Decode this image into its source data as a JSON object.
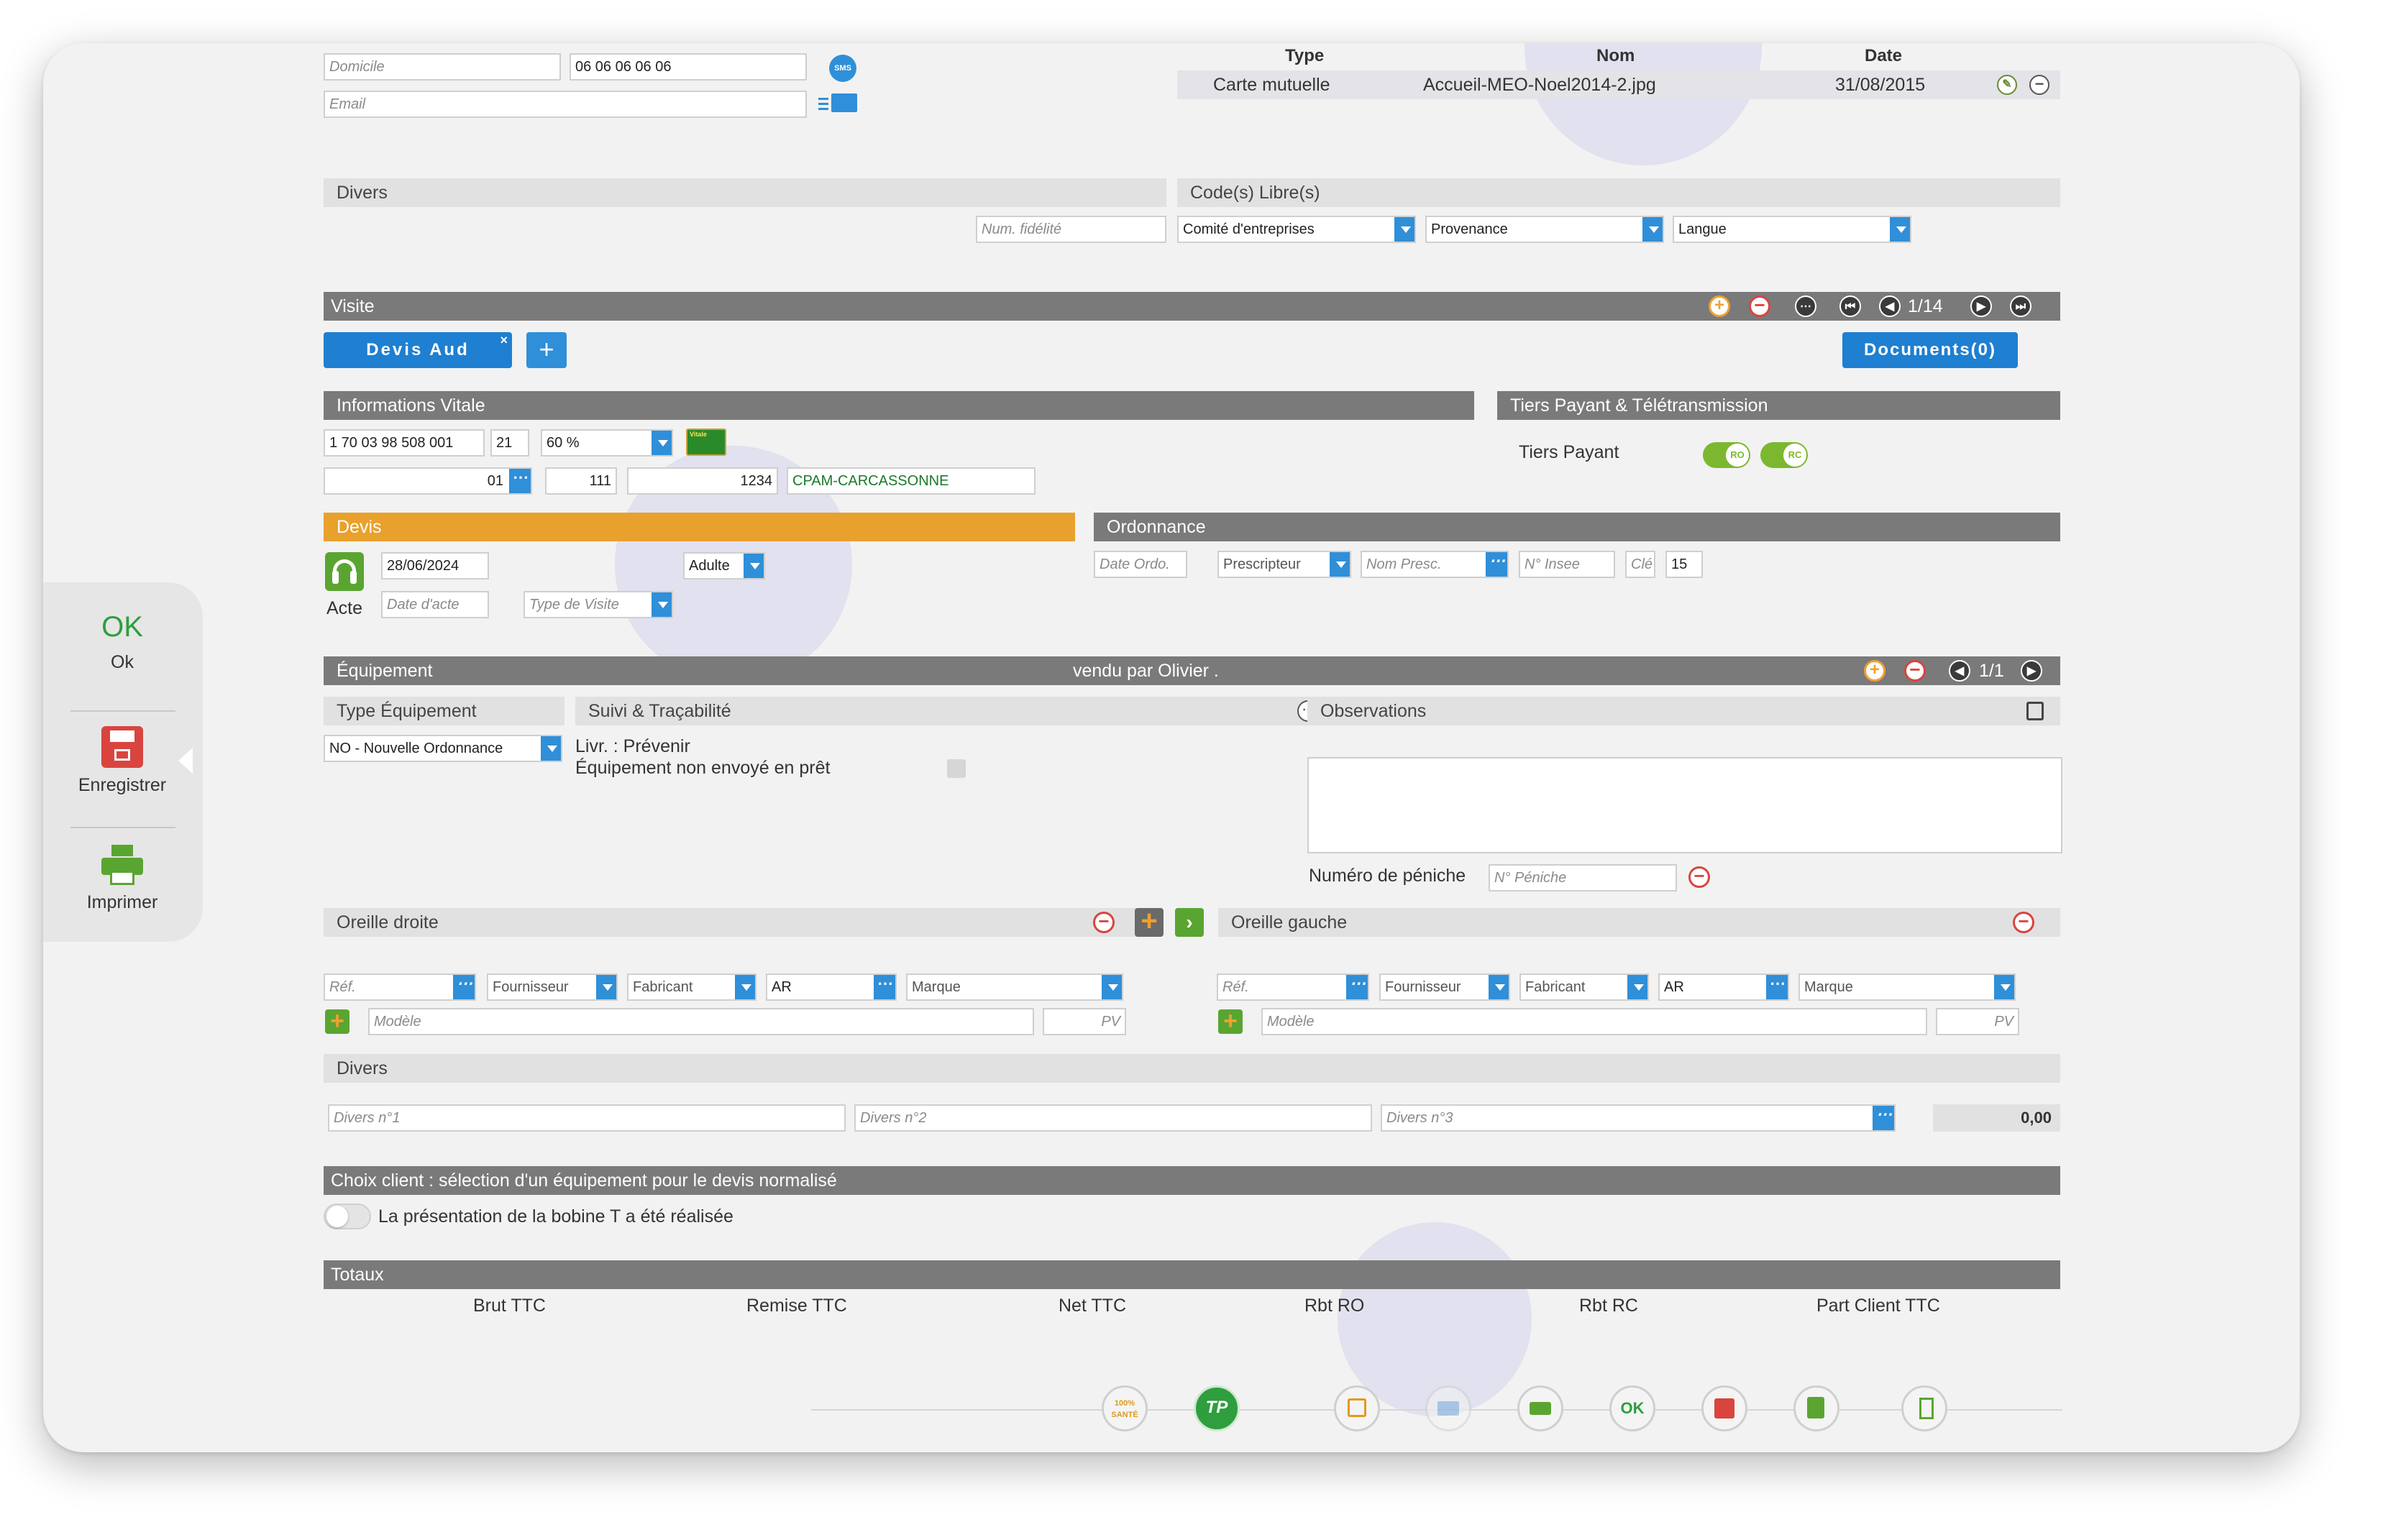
{
  "sidebar": {
    "ok_icon": "OK",
    "ok_label": "Ok",
    "save_label": "Enregistrer",
    "print_label": "Imprimer"
  },
  "contact": {
    "domicile_placeholder": "Domicile",
    "phone_value": "06 06 06 06 06",
    "email_placeholder": "Email",
    "sms_icon": "SMS"
  },
  "documents_table": {
    "headers": [
      "Type",
      "Nom",
      "Date"
    ],
    "row": {
      "type": "Carte mutuelle",
      "name": "Accueil-MEO-Noel2014-2.jpg",
      "date": "31/08/2015"
    }
  },
  "divers_top": {
    "title": "Divers",
    "fidelity_placeholder": "Num. fidélité"
  },
  "codes_libres": {
    "title": "Code(s) Libre(s)",
    "select1": "Comité d'entreprises",
    "select2": "Provenance",
    "select3": "Langue"
  },
  "visite": {
    "title": "Visite",
    "page": "1/14",
    "tab_label": "Devis Aud",
    "tab_close": "×",
    "add_label": "+",
    "documents_label": "Documents(0)"
  },
  "vitale": {
    "title": "Informations Vitale",
    "nir": "1 70 03 98 508 001",
    "key": "21",
    "rate": "60 %",
    "card_icon": "Vitale",
    "regime": "01",
    "caisse": "111",
    "centre": "1234",
    "cpam": "CPAM-CARCASSONNE"
  },
  "tiers": {
    "title": "Tiers Payant & Télétransmission",
    "label": "Tiers Payant",
    "toggle_ro": "RO",
    "toggle_rc": "RC"
  },
  "devis": {
    "title": "Devis",
    "date": "28/06/2024",
    "patient_type": "Adulte",
    "acte_label": "Acte",
    "date_acte_placeholder": "Date d'acte",
    "type_visite_placeholder": "Type de Visite"
  },
  "ordonnance": {
    "title": "Ordonnance",
    "date_placeholder": "Date Ordo.",
    "prescripteur": "Prescripteur",
    "nom_presc_placeholder": "Nom Presc.",
    "insee_placeholder": "N° Insee",
    "cle_placeholder": "Clé",
    "cle_value": "15"
  },
  "equipement": {
    "title": "Équipement",
    "seller": "vendu par Olivier .",
    "page": "1/1",
    "type_title": "Type Équipement",
    "type_value": "NO - Nouvelle Ordonnance",
    "suivi_title": "Suivi & Traçabilité",
    "livr_line": "Livr. : Prévenir",
    "pret_line": "Équipement non envoyé en prêt",
    "observations_title": "Observations",
    "peniche_label": "Numéro de péniche",
    "peniche_placeholder": "N° Péniche"
  },
  "oreilles": [
    {
      "title": "Oreille droite",
      "ref": "Réf.",
      "fournisseur": "Fournisseur",
      "fabricant": "Fabricant",
      "ar": "AR",
      "marque": "Marque",
      "modele": "Modèle",
      "pv": "PV"
    },
    {
      "title": "Oreille gauche",
      "ref": "Réf.",
      "fournisseur": "Fournisseur",
      "fabricant": "Fabricant",
      "ar": "AR",
      "marque": "Marque",
      "modele": "Modèle",
      "pv": "PV"
    }
  ],
  "divers": {
    "title": "Divers",
    "d1": "Divers n°1",
    "d2": "Divers n°2",
    "d3": "Divers n°3",
    "total": "0,00"
  },
  "choix": {
    "title": "Choix client : sélection d'un équipement pour le devis normalisé",
    "bobine_label": "La présentation de la bobine T a été réalisée"
  },
  "totaux": {
    "title": "Totaux",
    "columns": [
      "Brut TTC",
      "Remise TTC",
      "Net TTC",
      "Rbt RO",
      "Rbt RC",
      "Part Client TTC"
    ]
  },
  "bottom_toolbar": {
    "sante_icon": "100% SANTÉ",
    "tp_icon": "TP",
    "ok_icon": "OK"
  },
  "colors": {
    "accent_blue": "#2f8fd8",
    "header_gray": "#7a7a7a",
    "devis_orange": "#e9a12d",
    "toggle_green": "#7cb82f",
    "danger_red": "#d9443f",
    "ok_green": "#2e9e3e"
  }
}
